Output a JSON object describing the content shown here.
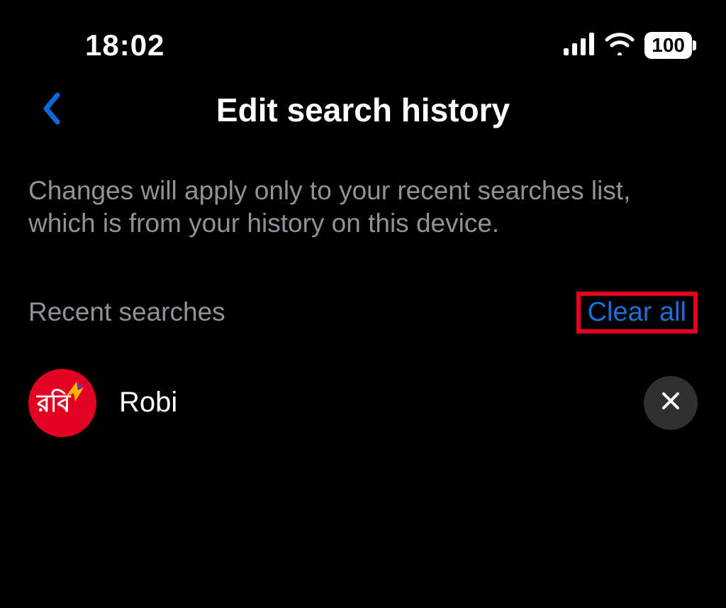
{
  "status": {
    "time": "18:02",
    "battery": "100"
  },
  "nav": {
    "title": "Edit search history"
  },
  "description": "Changes will apply only to your recent searches list, which is from your history on this device.",
  "section": {
    "label": "Recent searches",
    "clear_label": "Clear all"
  },
  "items": [
    {
      "name": "Robi",
      "avatar_text": "রবি"
    }
  ]
}
